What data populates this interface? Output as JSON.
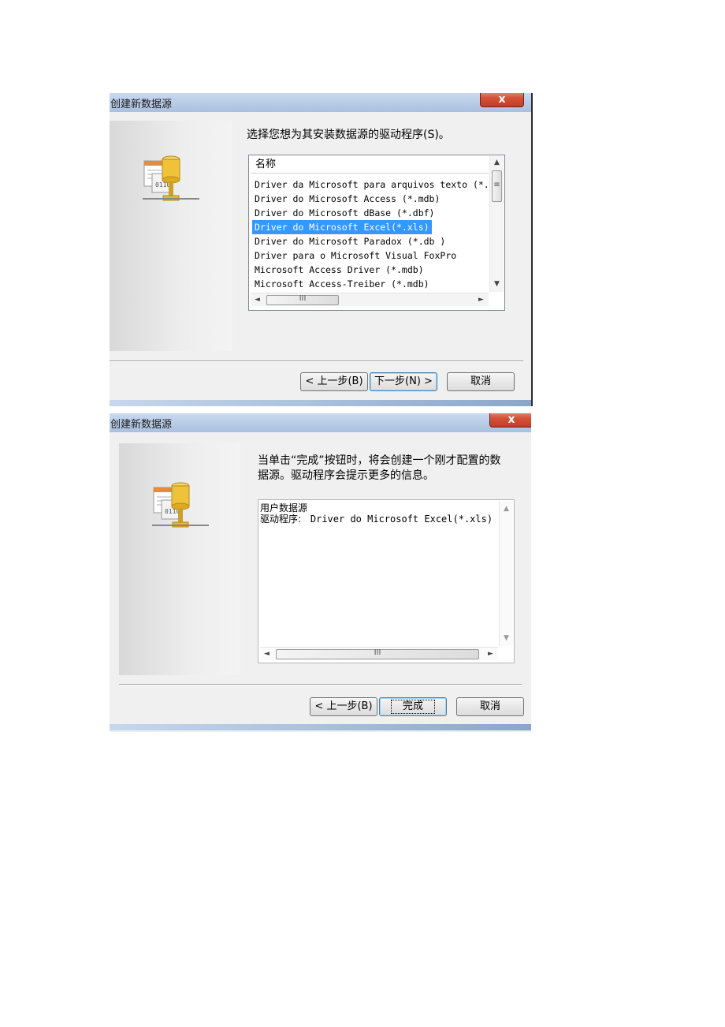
{
  "dialog1": {
    "title": "创建新数据源",
    "close_glyph": "x",
    "prompt": "选择您想为其安装数据源的驱动程序(S)。",
    "list_header": "名称",
    "drivers": [
      "Driver da Microsoft para arquivos texto (*.",
      "Driver do Microsoft Access (*.mdb)",
      "Driver do Microsoft dBase (*.dbf)",
      "Driver do Microsoft Excel(*.xls)",
      "Driver do Microsoft Paradox (*.db )",
      "Driver para o Microsoft Visual FoxPro",
      "Microsoft Access Driver (*.mdb)",
      "Microsoft Access-Treiber (*.mdb)"
    ],
    "selected_index": 3,
    "back_label": "< 上一步(B)",
    "next_label": "下一步(N) >",
    "cancel_label": "取消",
    "icon": "database-driver-icon"
  },
  "dialog2": {
    "title": "创建新数据源",
    "close_glyph": "x",
    "prompt_line1": "当单击“完成”按钮时，将会创建一个刚才配置的数",
    "prompt_line2": "据源。驱动程序会提示更多的信息。",
    "info_line1": "用户数据源",
    "info_line2_label": "驱动程序:",
    "info_line2_value": "Driver do Microsoft Excel(*.xls)",
    "back_label": "< 上一步(B)",
    "finish_label": "完成",
    "cancel_label": "取消",
    "icon": "database-driver-icon"
  },
  "scroll_glyphs": {
    "up": "▲",
    "down": "▼",
    "left": "◄",
    "right": "►",
    "grip_h": "III",
    "grip_v": "≡"
  },
  "colors": {
    "selection": "#3399ff",
    "titlebar": "#b7cbe6",
    "close": "#d4533a"
  }
}
